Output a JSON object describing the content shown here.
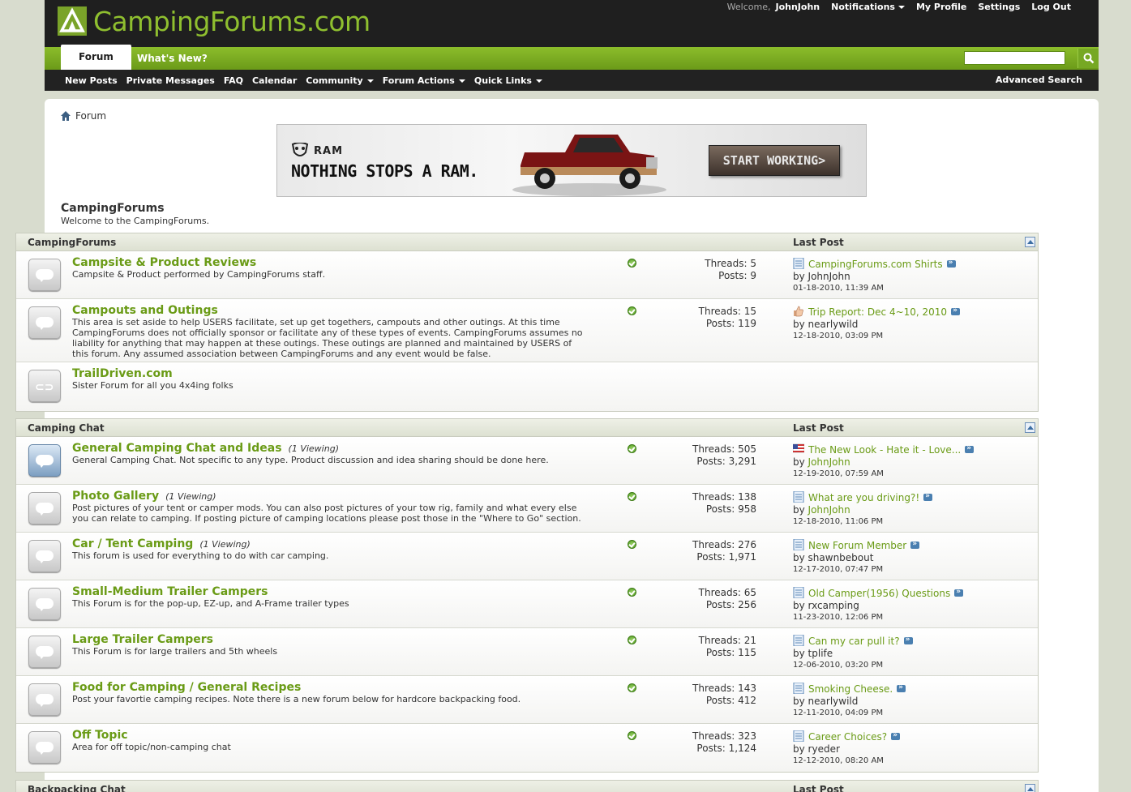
{
  "header": {
    "logo_text": "CampingForums.com",
    "welcome": "Welcome,",
    "username": "JohnJohn",
    "notifications": "Notifications",
    "my_profile": "My Profile",
    "settings": "Settings",
    "log_out": "Log Out"
  },
  "tabs": [
    "Forum",
    "What's New?"
  ],
  "search": {
    "placeholder": ""
  },
  "subnav": {
    "new_posts": "New Posts",
    "private_messages": "Private Messages",
    "faq": "FAQ",
    "calendar": "Calendar",
    "community": "Community",
    "forum_actions": "Forum Actions",
    "quick_links": "Quick Links",
    "advanced_search": "Advanced Search"
  },
  "breadcrumb": {
    "current": "Forum"
  },
  "ad": {
    "brand": "RAM",
    "slogan": "NOTHING STOPS A RAM.",
    "cta": "START WORKING>"
  },
  "site": {
    "title": "CampingForums",
    "subtitle": "Welcome to the CampingForums."
  },
  "categories": [
    {
      "name": "CampingForums",
      "last_post_header": "Last Post",
      "forums": [
        {
          "title": "Campsite & Product Reviews",
          "viewing": "",
          "description": "Campsite & Product performed by CampingForums staff.",
          "threads": "Threads: 5",
          "posts": "Posts: 9",
          "last_title": "CampingForums.com Shirts",
          "last_by_label": "by",
          "last_by": "JohnJohn",
          "last_date": "01-18-2010, 11:39 AM",
          "icon": "doc-icon"
        },
        {
          "title": "Campouts and Outings",
          "viewing": "",
          "description": "This area is set aside to help USERS facilitate, set up get togethers, campouts and other outings. At this time CampingForums does not officially sponsor or facilitate any of these types of events. CampingForums assumes no liability for anything that may happen at these outings. These outings are planned and maintained by USERS of this forum. Any assumed association between CampingForums and any event would be false.",
          "threads": "Threads: 15",
          "posts": "Posts: 119",
          "last_title": "Trip Report: Dec 4~10, 2010",
          "last_by_label": "by",
          "last_by": "nearlywild",
          "last_date": "12-18-2010, 03:09 PM",
          "icon": "thumbs-up-icon"
        },
        {
          "title": "TrailDriven.com",
          "viewing": "",
          "description": "Sister Forum for all you 4x4ing folks",
          "link_forum": true
        }
      ]
    },
    {
      "name": "Camping Chat",
      "last_post_header": "Last Post",
      "forums": [
        {
          "title": "General Camping Chat and Ideas",
          "viewing": "(1 Viewing)",
          "description": "General Camping Chat. Not specific to any type. Product discussion and idea sharing should be done here.",
          "threads": "Threads: 505",
          "posts": "Posts: 3,291",
          "last_title": "The New Look - Hate it - Love...",
          "last_by_label": "by",
          "last_by": "JohnJohn",
          "last_date": "12-19-2010, 07:59 AM",
          "icon": "flag-icon",
          "new": true
        },
        {
          "title": "Photo Gallery",
          "viewing": "(1 Viewing)",
          "description": "Post pictures of your tent or camper mods. You can also post pictures of your tow rig, family and what every else you can relate to camping. If posting picture of camping locations please post those in the \"Where to Go\" section.",
          "threads": "Threads: 138",
          "posts": "Posts: 958",
          "last_title": "What are you driving?!",
          "last_by_label": "by",
          "last_by": "JohnJohn",
          "last_date": "12-18-2010, 11:06 PM",
          "icon": "doc-icon"
        },
        {
          "title": "Car / Tent Camping",
          "viewing": "(1 Viewing)",
          "description": "This forum is used for everything to do with car camping.",
          "threads": "Threads: 276",
          "posts": "Posts: 1,971",
          "last_title": "New Forum Member",
          "last_by_label": "by",
          "last_by": "shawnbebout",
          "last_date": "12-17-2010, 07:47 PM",
          "icon": "doc-icon"
        },
        {
          "title": "Small-Medium Trailer Campers",
          "viewing": "",
          "description": "This Forum is for the pop-up, EZ-up, and A-Frame trailer types",
          "threads": "Threads: 65",
          "posts": "Posts: 256",
          "last_title": "Old Camper(1956) Questions",
          "last_by_label": "by",
          "last_by": "rxcamping",
          "last_date": "11-23-2010, 12:06 PM",
          "icon": "doc-icon"
        },
        {
          "title": "Large Trailer Campers",
          "viewing": "",
          "description": "This Forum is for large trailers and 5th wheels",
          "threads": "Threads: 21",
          "posts": "Posts: 115",
          "last_title": "Can my car pull it?",
          "last_by_label": "by",
          "last_by": "tplife",
          "last_date": "12-06-2010, 03:20 PM",
          "icon": "doc-icon"
        },
        {
          "title": "Food for Camping / General Recipes",
          "viewing": "",
          "description": "Post your favortie camping recipes. Note there is a new forum below for hardcore backpacking food.",
          "threads": "Threads: 143",
          "posts": "Posts: 412",
          "last_title": "Smoking Cheese.",
          "last_by_label": "by",
          "last_by": "nearlywild",
          "last_date": "12-11-2010, 04:09 PM",
          "icon": "doc-icon"
        },
        {
          "title": "Off Topic",
          "viewing": "",
          "description": "Area for off topic/non-camping chat",
          "threads": "Threads: 323",
          "posts": "Posts: 1,124",
          "last_title": "Career Choices?",
          "last_by_label": "by",
          "last_by": "ryeder",
          "last_date": "12-12-2010, 08:20 AM",
          "icon": "doc-icon"
        }
      ]
    },
    {
      "name": "Backpacking Chat",
      "last_post_header": "Last Post",
      "forums": []
    }
  ],
  "colors": {
    "brand_green": "#8fbf2f",
    "link_green": "#6a9b16",
    "header_dark": "#1f1f1f",
    "page_bg": "#d8dcce"
  }
}
